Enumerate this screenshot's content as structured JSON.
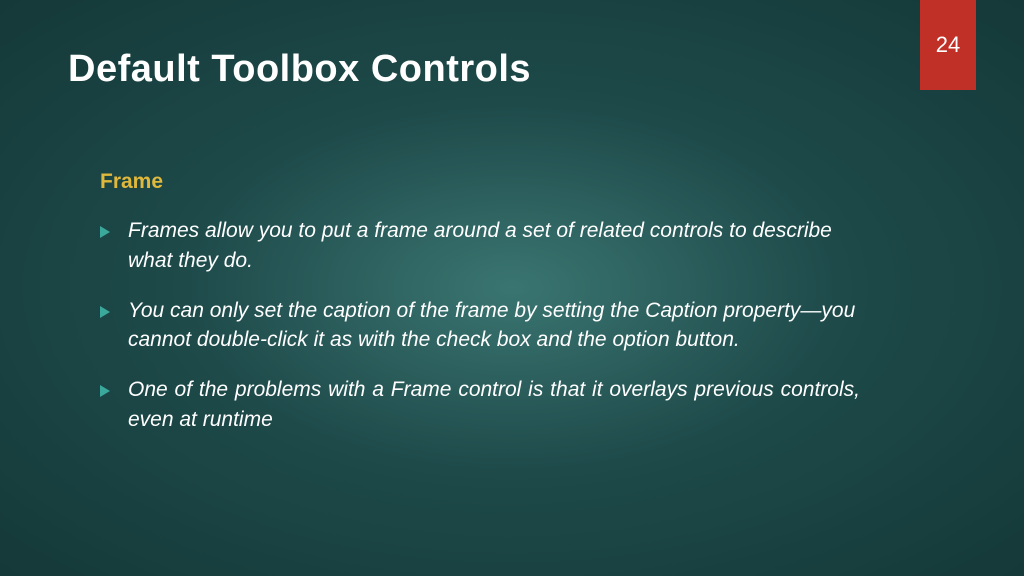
{
  "pageNumber": "24",
  "title": "Default Toolbox Controls",
  "subheading": "Frame",
  "bullets": [
    "Frames allow you to put a frame around a set of related controls to describe what they do.",
    "You can only set the caption of the frame by setting the Caption property—you cannot double-click it as with the check box and the option button.",
    "One of the problems with a Frame control is that it overlays previous controls, even at runtime"
  ]
}
